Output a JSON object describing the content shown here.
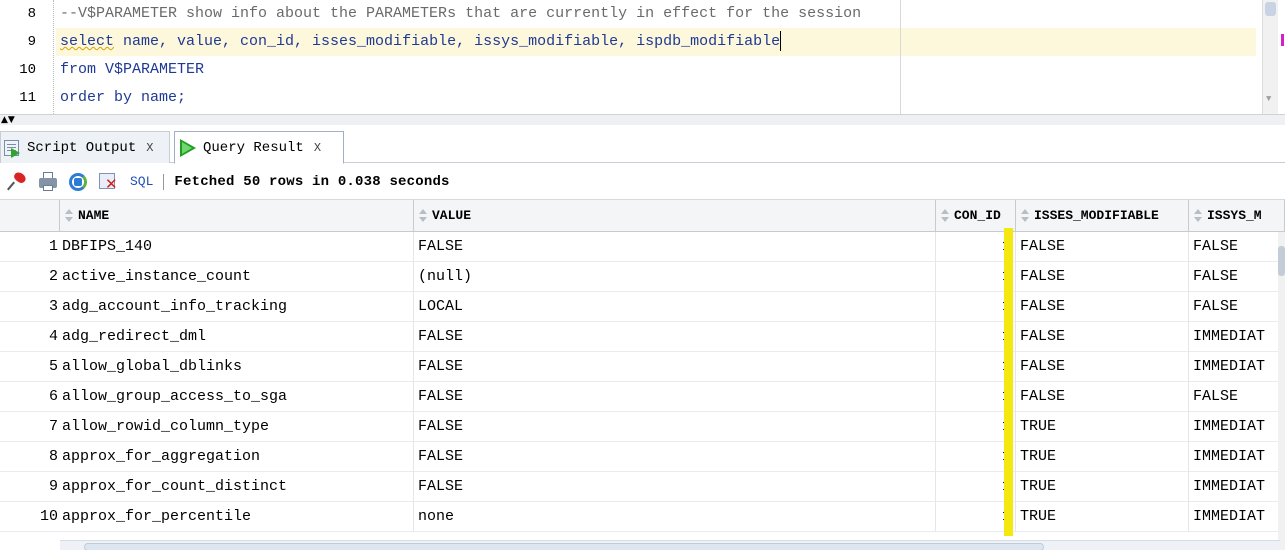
{
  "editor": {
    "lines": [
      {
        "number": "8",
        "text": "--V$PARAMETER show info about the PARAMETERs that are currently in effect for the session",
        "kind": "comment"
      },
      {
        "number": "9",
        "text_keyword": "select",
        "text_rest": " name, value, con_id, isses_modifiable, issys_modifiable, ispdb_modifiable",
        "kind": "code-current"
      },
      {
        "number": "10",
        "text": "from V$PARAMETER",
        "kind": "code"
      },
      {
        "number": "11",
        "text": "order by name;",
        "kind": "code"
      }
    ]
  },
  "tabs": [
    {
      "label": "Script Output",
      "close": "X",
      "icon": "script-output-icon",
      "active": false
    },
    {
      "label": "Query Result",
      "close": "X",
      "icon": "run-query-icon",
      "active": true
    }
  ],
  "toolbar": {
    "icons": [
      "pin-icon",
      "print-icon",
      "refresh-icon",
      "cancel-query-icon"
    ],
    "sql_label": "SQL",
    "status": "Fetched 50 rows in 0.038 seconds"
  },
  "grid": {
    "columns": [
      "NAME",
      "VALUE",
      "CON_ID",
      "ISSES_MODIFIABLE",
      "ISSYS_M"
    ],
    "rows": [
      {
        "num": "1",
        "name": "DBFIPS_140",
        "value": "FALSE",
        "con_id": "1",
        "isses": "FALSE",
        "issys": "FALSE"
      },
      {
        "num": "2",
        "name": "active_instance_count",
        "value": "(null)",
        "con_id": "1",
        "isses": "FALSE",
        "issys": "FALSE"
      },
      {
        "num": "3",
        "name": "adg_account_info_tracking",
        "value": "LOCAL",
        "con_id": "1",
        "isses": "FALSE",
        "issys": "FALSE"
      },
      {
        "num": "4",
        "name": "adg_redirect_dml",
        "value": "FALSE",
        "con_id": "1",
        "isses": "FALSE",
        "issys": "IMMEDIAT"
      },
      {
        "num": "5",
        "name": "allow_global_dblinks",
        "value": "FALSE",
        "con_id": "1",
        "isses": "FALSE",
        "issys": "IMMEDIAT"
      },
      {
        "num": "6",
        "name": "allow_group_access_to_sga",
        "value": "FALSE",
        "con_id": "1",
        "isses": "FALSE",
        "issys": "FALSE"
      },
      {
        "num": "7",
        "name": "allow_rowid_column_type",
        "value": "FALSE",
        "con_id": "1",
        "isses": "TRUE",
        "issys": "IMMEDIAT"
      },
      {
        "num": "8",
        "name": "approx_for_aggregation",
        "value": "FALSE",
        "con_id": "1",
        "isses": "TRUE",
        "issys": "IMMEDIAT"
      },
      {
        "num": "9",
        "name": "approx_for_count_distinct",
        "value": "FALSE",
        "con_id": "1",
        "isses": "TRUE",
        "issys": "IMMEDIAT"
      },
      {
        "num": "10",
        "name": "approx_for_percentile",
        "value": "none",
        "con_id": "1",
        "isses": "TRUE",
        "issys": "IMMEDIAT"
      }
    ]
  },
  "colors": {
    "keyword": "#1f3a93",
    "comment": "#6a6a6a",
    "current_line": "#fdf7dc",
    "highlight": "#f4e810"
  }
}
